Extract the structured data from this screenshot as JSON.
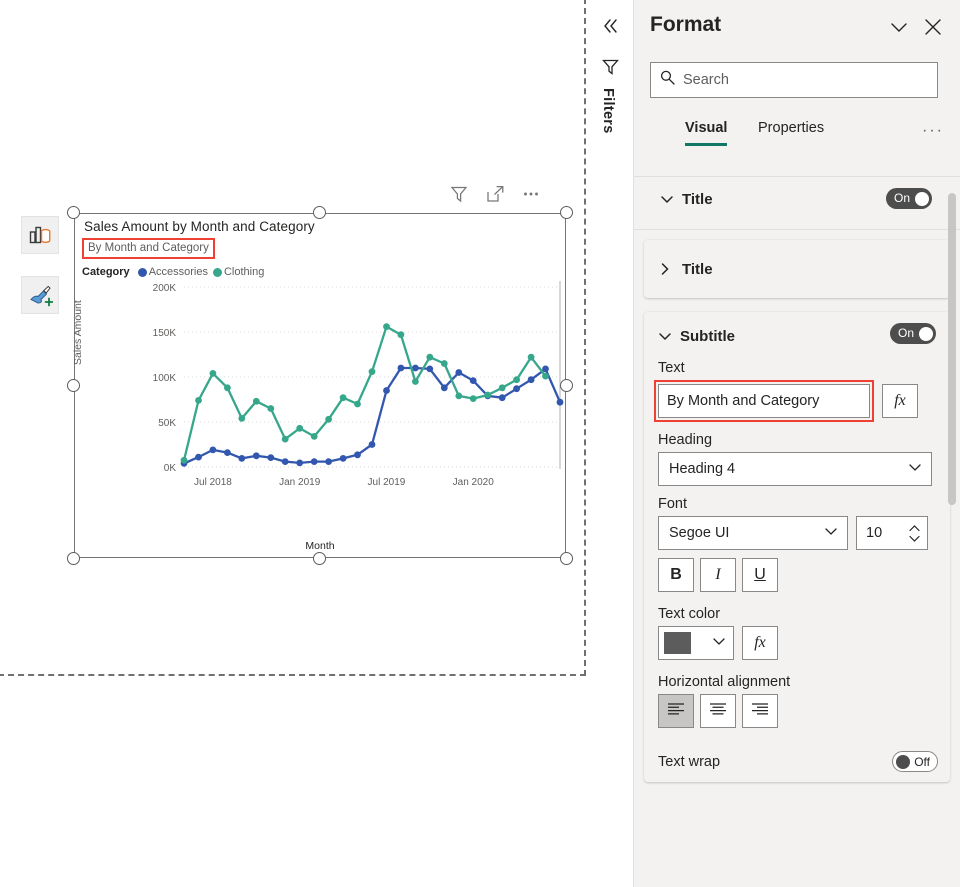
{
  "canvas": {
    "floating_toolbar": [
      {
        "name": "change-visual-type",
        "icon": "bar-chart-cylinder-icon"
      },
      {
        "name": "format-painter",
        "icon": "paintbrush-plus-icon"
      }
    ],
    "visual_header_icons": [
      "filter-icon",
      "focus-mode-icon",
      "more-options-icon"
    ]
  },
  "visual": {
    "title": "Sales Amount by Month and Category",
    "subtitle": "By Month and Category",
    "legend_title": "Category",
    "legend": [
      {
        "label": "Accessories",
        "color": "#3257AE"
      },
      {
        "label": "Clothing",
        "color": "#37A78B"
      }
    ]
  },
  "chart_data": {
    "type": "line",
    "title": "Sales Amount by Month and Category",
    "subtitle": "By Month and Category",
    "xlabel": "Month",
    "ylabel": "Sales Amount",
    "ylim": [
      0,
      200000
    ],
    "ytick_labels": [
      "0K",
      "50K",
      "100K",
      "150K",
      "200K"
    ],
    "ytick_values": [
      0,
      50000,
      100000,
      150000,
      200000
    ],
    "xtick_labels": [
      "Jul 2018",
      "Jan 2019",
      "Jul 2019",
      "Jan 2020"
    ],
    "grid": true,
    "legend_position": "top-left",
    "markers": true,
    "x": [
      "May 2018",
      "Jun 2018",
      "Jul 2018",
      "Aug 2018",
      "Sep 2018",
      "Oct 2018",
      "Nov 2018",
      "Dec 2018",
      "Jan 2019",
      "Feb 2019",
      "Mar 2019",
      "Apr 2019",
      "May 2019",
      "Jun 2019",
      "Jul 2019",
      "Aug 2019",
      "Sep 2019",
      "Oct 2019",
      "Nov 2019",
      "Dec 2019",
      "Jan 2020",
      "Feb 2020",
      "Mar 2020",
      "Apr 2020",
      "May 2020",
      "Jun 2020",
      "Jul 2020"
    ],
    "series": [
      {
        "name": "Accessories",
        "color": "#3257AE",
        "values": [
          4000,
          11000,
          19000,
          16000,
          9500,
          12500,
          10500,
          6000,
          4500,
          6000,
          6000,
          9500,
          13500,
          25000,
          85000,
          110000,
          110000,
          109000,
          88000,
          105000,
          96000,
          79000,
          77000,
          87000,
          97000,
          109000,
          72000
        ]
      },
      {
        "name": "Clothing",
        "color": "#37A78B",
        "values": [
          7500,
          74000,
          104000,
          88000,
          54000,
          73000,
          65000,
          31000,
          43000,
          34000,
          53000,
          77000,
          70000,
          106000,
          156000,
          147000,
          95000,
          122000,
          115000,
          79000,
          76000,
          80000,
          88000,
          97000,
          122000,
          101000
        ]
      }
    ]
  },
  "filters_rail": {
    "collapse_icon": "chevron-double-left-icon",
    "filter_icon": "filter-funnel-icon",
    "label": "Filters"
  },
  "format_pane": {
    "title": "Format",
    "collapse_icon": "chevron-down-icon",
    "close_icon": "close-icon",
    "search": {
      "icon": "search-icon",
      "placeholder": "Search",
      "value": ""
    },
    "tabs": [
      {
        "label": "Visual",
        "selected": true
      },
      {
        "label": "Properties",
        "selected": false
      }
    ],
    "more_label": "···",
    "accent_color": "#117865",
    "cards": {
      "title_card": {
        "label": "Title",
        "expanded": true,
        "toggle": {
          "state": "On",
          "on": true
        }
      },
      "title_subcard": {
        "label": "Title",
        "expanded": false
      },
      "subtitle_card": {
        "label": "Subtitle",
        "expanded": true,
        "toggle": {
          "state": "On",
          "on": true
        },
        "text_field": {
          "label": "Text",
          "value": "By Month and Category",
          "fx_label": "fx",
          "highlighted": true
        },
        "heading": {
          "label": "Heading",
          "value": "Heading 4"
        },
        "font": {
          "label": "Font",
          "family": "Segoe UI",
          "size": "10",
          "bold_label": "B",
          "italic_label": "I",
          "underline_label": "U"
        },
        "text_color": {
          "label": "Text color",
          "swatch": "#5C5C5C",
          "fx_label": "fx"
        },
        "horizontal_alignment": {
          "label": "Horizontal alignment",
          "options": [
            "align-left",
            "align-center",
            "align-right"
          ],
          "selected": "align-left"
        },
        "text_wrap": {
          "label": "Text wrap",
          "toggle": {
            "state": "Off",
            "on": false
          }
        }
      }
    }
  }
}
